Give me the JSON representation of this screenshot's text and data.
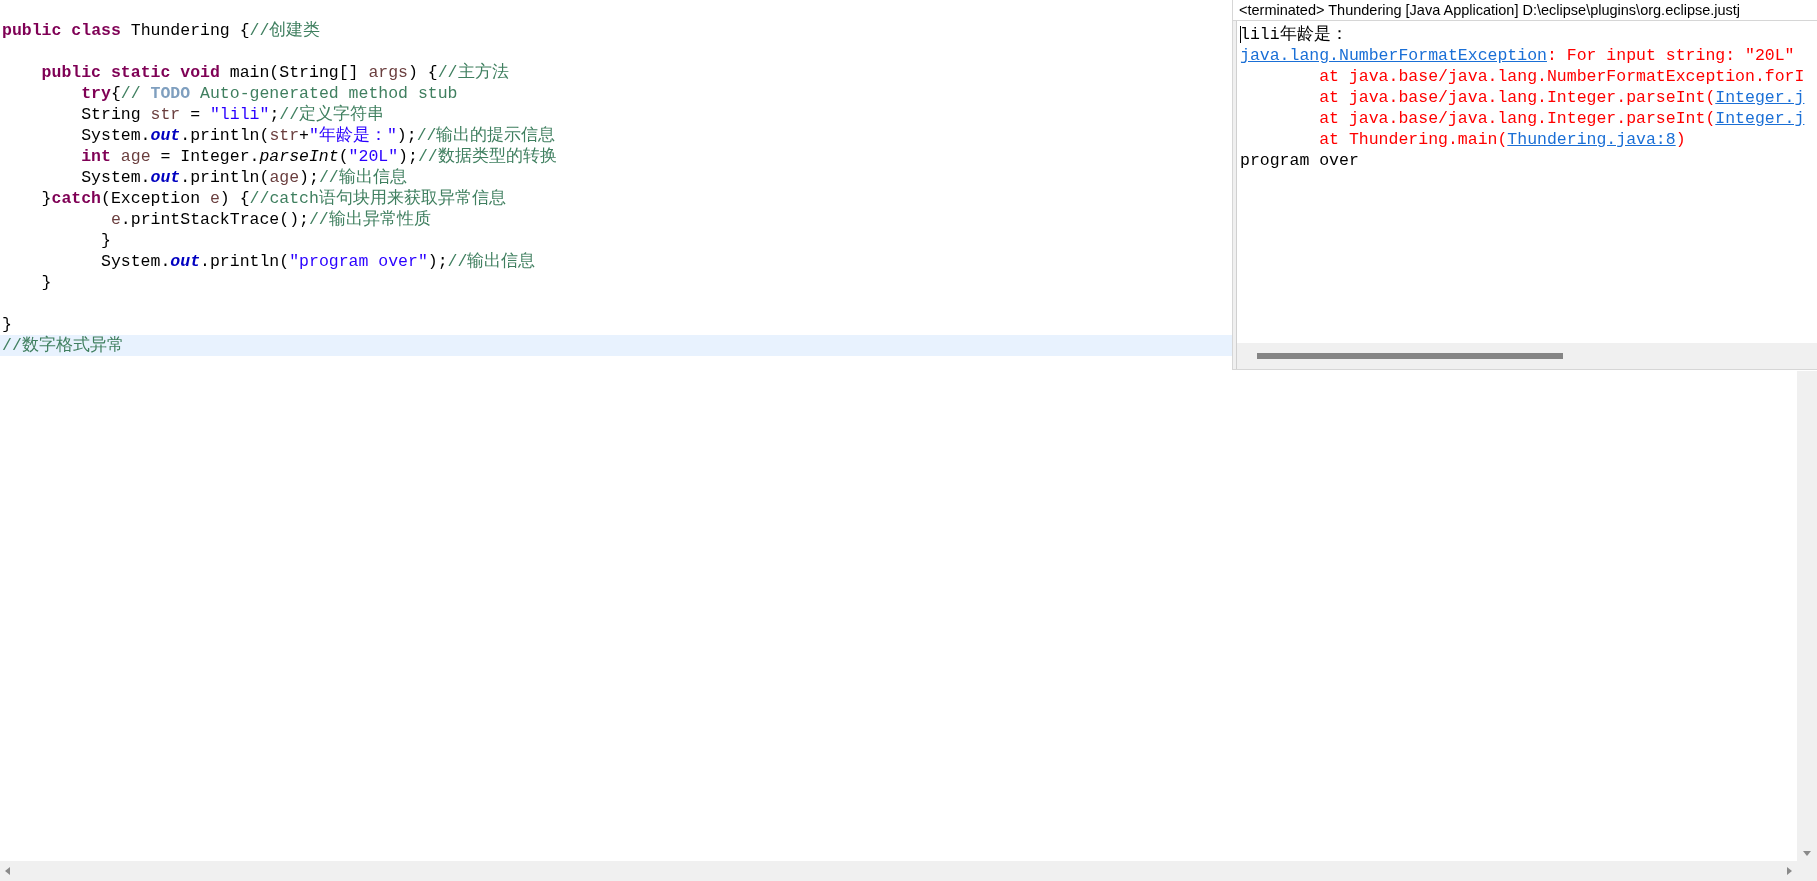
{
  "editor": {
    "lines": [
      {
        "current": false,
        "tokens": [
          {
            "kind": "keyword",
            "text": "public"
          },
          {
            "kind": "keyword",
            "text": " class"
          },
          {
            "kind": "plain",
            "text": " Thundering {"
          },
          {
            "kind": "comment",
            "text": "//创建类"
          }
        ]
      },
      {
        "current": false
      },
      {
        "current": false,
        "tokens": [
          {
            "kind": "keyword",
            "text": "    public"
          },
          {
            "kind": "keyword",
            "text": " static"
          },
          {
            "kind": "keyword",
            "text": " void"
          },
          {
            "kind": "plain",
            "text": " main(String[] "
          },
          {
            "kind": "local",
            "text": "args"
          },
          {
            "kind": "plain",
            "text": ") {"
          },
          {
            "kind": "comment",
            "text": "//主方法"
          }
        ]
      },
      {
        "current": false,
        "tokens": [
          {
            "kind": "keyword",
            "text": "        try"
          },
          {
            "kind": "plain",
            "text": "{"
          },
          {
            "kind": "comment",
            "text": "// "
          },
          {
            "kind": "todo",
            "text": "TODO"
          },
          {
            "kind": "comment",
            "text": " Auto-generated method stub"
          }
        ]
      },
      {
        "current": false,
        "tokens": [
          {
            "kind": "plain",
            "text": "        String "
          },
          {
            "kind": "local",
            "text": "str"
          },
          {
            "kind": "plain",
            "text": " = "
          },
          {
            "kind": "string",
            "text": "\"lili\""
          },
          {
            "kind": "plain",
            "text": ";"
          },
          {
            "kind": "comment",
            "text": "//定义字符串"
          }
        ]
      },
      {
        "current": false,
        "tokens": [
          {
            "kind": "plain",
            "text": "        System."
          },
          {
            "kind": "field",
            "text": "out"
          },
          {
            "kind": "plain",
            "text": ".println("
          },
          {
            "kind": "local",
            "text": "str"
          },
          {
            "kind": "plain",
            "text": "+"
          },
          {
            "kind": "string",
            "text": "\"年龄是：\""
          },
          {
            "kind": "plain",
            "text": ");"
          },
          {
            "kind": "comment",
            "text": "//输出的提示信息"
          }
        ]
      },
      {
        "current": false,
        "tokens": [
          {
            "kind": "keyword",
            "text": "        int"
          },
          {
            "kind": "local",
            "text": " age"
          },
          {
            "kind": "plain",
            "text": " = Integer."
          },
          {
            "kind": "method",
            "text": "parseInt"
          },
          {
            "kind": "plain",
            "text": "("
          },
          {
            "kind": "string",
            "text": "\"20L\""
          },
          {
            "kind": "plain",
            "text": ");"
          },
          {
            "kind": "comment",
            "text": "//数据类型的转换"
          }
        ]
      },
      {
        "current": false,
        "tokens": [
          {
            "kind": "plain",
            "text": "        System."
          },
          {
            "kind": "field",
            "text": "out"
          },
          {
            "kind": "plain",
            "text": ".println("
          },
          {
            "kind": "local",
            "text": "age"
          },
          {
            "kind": "plain",
            "text": ");"
          },
          {
            "kind": "comment",
            "text": "//输出信息"
          }
        ]
      },
      {
        "current": false,
        "tokens": [
          {
            "kind": "plain",
            "text": "    }"
          },
          {
            "kind": "keyword",
            "text": "catch"
          },
          {
            "kind": "plain",
            "text": "(Exception "
          },
          {
            "kind": "local",
            "text": "e"
          },
          {
            "kind": "plain",
            "text": ") {"
          },
          {
            "kind": "comment",
            "text": "//catch语句块用来获取异常信息"
          }
        ]
      },
      {
        "current": false,
        "tokens": [
          {
            "kind": "local",
            "text": "           e"
          },
          {
            "kind": "plain",
            "text": ".printStackTrace();"
          },
          {
            "kind": "comment",
            "text": "//输出异常性质"
          }
        ]
      },
      {
        "current": false,
        "tokens": [
          {
            "kind": "plain",
            "text": "          }"
          }
        ]
      },
      {
        "current": false,
        "tokens": [
          {
            "kind": "plain",
            "text": "          System."
          },
          {
            "kind": "field",
            "text": "out"
          },
          {
            "kind": "plain",
            "text": ".println("
          },
          {
            "kind": "string",
            "text": "\"program over\""
          },
          {
            "kind": "plain",
            "text": ");"
          },
          {
            "kind": "comment",
            "text": "//输出信息"
          }
        ]
      },
      {
        "current": false,
        "tokens": [
          {
            "kind": "plain",
            "text": "    }"
          }
        ]
      },
      {
        "current": false
      },
      {
        "current": false,
        "tokens": [
          {
            "kind": "plain",
            "text": "}"
          }
        ]
      },
      {
        "current": true,
        "tokens": [
          {
            "kind": "comment",
            "text": "//数字格式异常"
          }
        ]
      }
    ]
  },
  "console": {
    "title": "<terminated> Thundering [Java Application] D:\\eclipse\\plugins\\org.eclipse.justj",
    "lines": [
      {
        "tokens": [
          {
            "kind": "out",
            "text": "lili年龄是："
          }
        ]
      },
      {
        "tokens": [
          {
            "kind": "link",
            "text": "java.lang.NumberFormatException"
          },
          {
            "kind": "err",
            "text": ": For input string: \"20L\""
          }
        ]
      },
      {
        "tokens": [
          {
            "kind": "err",
            "text": "        at java.base/java.lang.NumberFormatException.forI"
          }
        ]
      },
      {
        "tokens": [
          {
            "kind": "err",
            "text": "        at java.base/java.lang.Integer.parseInt("
          },
          {
            "kind": "link",
            "text": "Integer.j"
          }
        ]
      },
      {
        "tokens": [
          {
            "kind": "err",
            "text": "        at java.base/java.lang.Integer.parseInt("
          },
          {
            "kind": "link",
            "text": "Integer.j"
          }
        ]
      },
      {
        "tokens": [
          {
            "kind": "err",
            "text": "        at Thundering.main("
          },
          {
            "kind": "link",
            "text": "Thundering.java:8"
          },
          {
            "kind": "err",
            "text": ")"
          }
        ]
      },
      {
        "tokens": [
          {
            "kind": "out",
            "text": "program over"
          }
        ]
      }
    ]
  }
}
